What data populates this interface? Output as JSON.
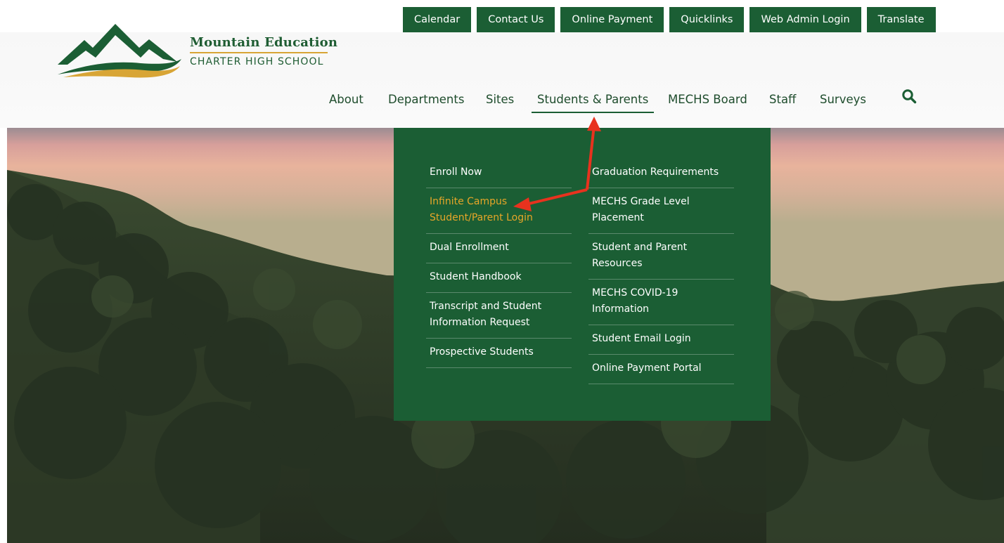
{
  "logo": {
    "title": "Mountain Education",
    "subtitle": "CHARTER HIGH SCHOOL",
    "icon": "mountain-logo-icon"
  },
  "utility_nav": [
    {
      "label": "Calendar"
    },
    {
      "label": "Contact Us"
    },
    {
      "label": "Online Payment"
    },
    {
      "label": "Quicklinks"
    },
    {
      "label": "Web Admin Login"
    },
    {
      "label": "Translate"
    }
  ],
  "main_nav": [
    {
      "label": "About"
    },
    {
      "label": "Departments"
    },
    {
      "label": "Sites"
    },
    {
      "label": "Students & Parents",
      "active": true
    },
    {
      "label": "MECHS Board"
    },
    {
      "label": "Staff"
    },
    {
      "label": "Surveys"
    }
  ],
  "search": {
    "icon": "search-icon"
  },
  "dropdown": {
    "left_column": [
      {
        "label": "Enroll Now"
      },
      {
        "label": "Infinite Campus Student/Parent Login",
        "highlight": true
      },
      {
        "label": "Dual Enrollment"
      },
      {
        "label": "Student Handbook"
      },
      {
        "label": "Transcript and Student Information Request"
      },
      {
        "label": "Prospective Students"
      }
    ],
    "right_column": [
      {
        "label": "Graduation Requirements"
      },
      {
        "label": "MECHS Grade Level Placement"
      },
      {
        "label": "Student and Parent Resources"
      },
      {
        "label": "MECHS COVID-19 Information"
      },
      {
        "label": "Student Email Login"
      },
      {
        "label": "Online Payment Portal"
      }
    ]
  },
  "colors": {
    "brand_green": "#1b5e34",
    "accent_gold": "#e7a628",
    "annotation_red": "#e8321e"
  }
}
